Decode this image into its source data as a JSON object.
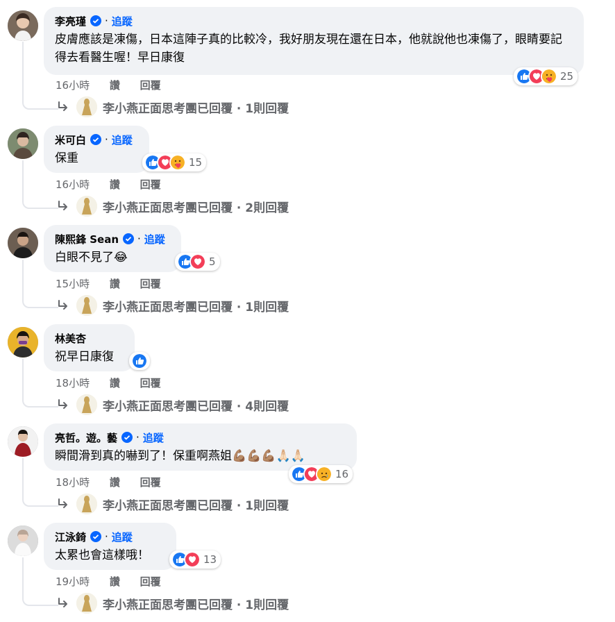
{
  "colors": {
    "link": "#0866ff",
    "muted": "#65676b",
    "bubble": "#f0f2f5"
  },
  "labels": {
    "like": "讚",
    "reply": "回覆",
    "follow": "追蹤",
    "separator": "·"
  },
  "comments": [
    {
      "name": "李亮瑾",
      "verified": true,
      "follow": true,
      "text": "皮膚應該是凍傷，日本這陣子真的比較冷，我好朋友現在還在日本，他就說他也凍傷了，眼睛要記得去看醫生喔！早日康復",
      "reactions": [
        "like-icon",
        "love-icon",
        "care-icon"
      ],
      "reaction_count": "25",
      "time": "16小時",
      "reply_summary": "李小燕正面思考團已回覆 · 1則回覆"
    },
    {
      "name": "米可白",
      "verified": true,
      "follow": true,
      "text": "保重",
      "reactions": [
        "like-icon",
        "love-icon",
        "care-icon"
      ],
      "reaction_count": "15",
      "time": "16小時",
      "reply_summary": "李小燕正面思考團已回覆 · 2則回覆"
    },
    {
      "name": "陳熙鋒 Sean",
      "verified": true,
      "follow": true,
      "text": "白眼不見了😂",
      "reactions": [
        "like-icon",
        "love-icon"
      ],
      "reaction_count": "5",
      "time": "15小時",
      "reply_summary": "李小燕正面思考團已回覆 · 1則回覆"
    },
    {
      "name": "林美杏",
      "verified": false,
      "follow": false,
      "text": "祝早日康復",
      "reactions": [
        "like-icon"
      ],
      "reaction_count": "",
      "time": "18小時",
      "reply_summary": "李小燕正面思考團已回覆 · 4則回覆"
    },
    {
      "name": "亮哲。遊。藝",
      "verified": true,
      "follow": true,
      "text": "瞬間滑到真的嚇到了！保重啊燕姐💪🏽💪🏽💪🏽🙏🏻🙏🏻",
      "reactions": [
        "like-icon",
        "love-icon",
        "sad-icon"
      ],
      "reaction_count": "16",
      "time": "18小時",
      "reply_summary": "李小燕正面思考團已回覆 · 1則回覆"
    },
    {
      "name": "江泳錡",
      "verified": true,
      "follow": true,
      "text": "太累也會這樣哦！",
      "reactions": [
        "like-icon",
        "love-icon"
      ],
      "reaction_count": "13",
      "time": "19小時",
      "reply_summary": "李小燕正面思考團已回覆 · 1則回覆"
    }
  ]
}
